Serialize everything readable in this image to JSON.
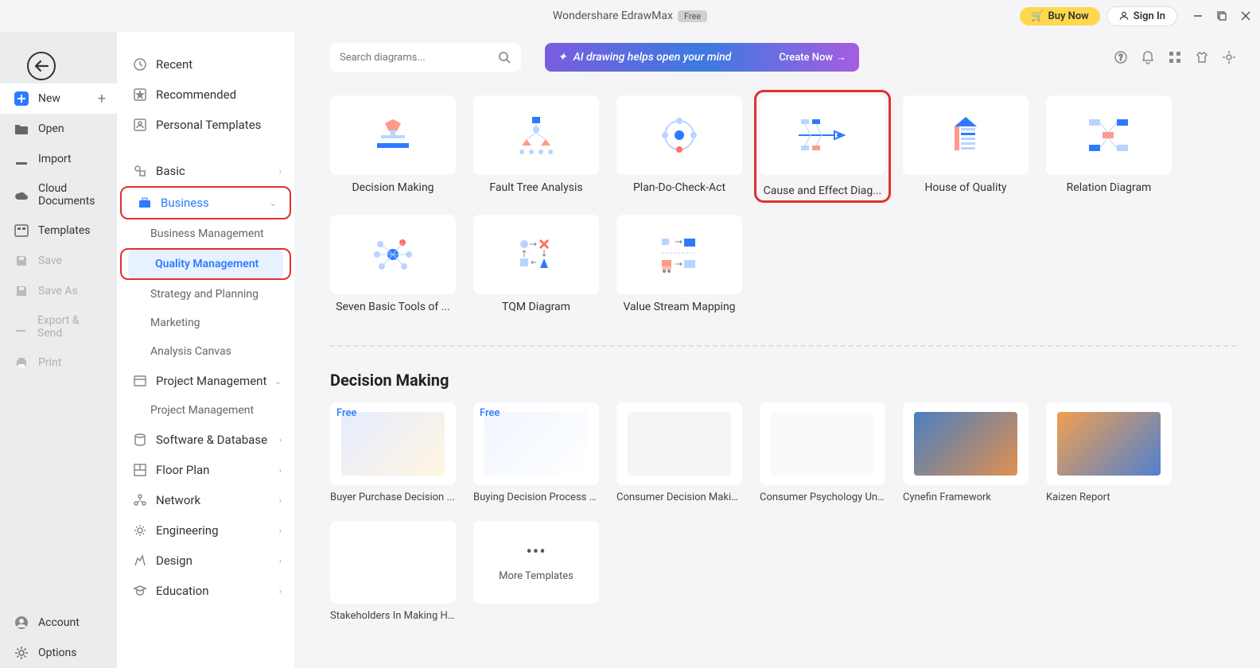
{
  "titlebar": {
    "app_name": "Wondershare EdrawMax",
    "badge": "Free",
    "buy_now": "Buy Now",
    "sign_in": "Sign In"
  },
  "leftbar": {
    "new": "New",
    "open": "Open",
    "import": "Import",
    "cloud_documents": "Cloud Documents",
    "templates": "Templates",
    "save": "Save",
    "save_as": "Save As",
    "export_send": "Export & Send",
    "print": "Print",
    "account": "Account",
    "options": "Options"
  },
  "categories": {
    "recent": "Recent",
    "recommended": "Recommended",
    "personal_templates": "Personal Templates",
    "basic": "Basic",
    "business": "Business",
    "business_subs": {
      "business_management": "Business Management",
      "quality_management": "Quality Management",
      "strategy_planning": "Strategy and Planning",
      "marketing": "Marketing",
      "analysis_canvas": "Analysis Canvas"
    },
    "project_management": "Project Management",
    "project_management_sub": "Project Management",
    "software_database": "Software & Database",
    "floor_plan": "Floor Plan",
    "network": "Network",
    "engineering": "Engineering",
    "design": "Design",
    "education": "Education"
  },
  "search": {
    "placeholder": "Search diagrams..."
  },
  "ai_banner": {
    "text": "AI drawing helps open your mind",
    "cta": "Create Now"
  },
  "cards": [
    "Decision Making",
    "Fault Tree Analysis",
    "Plan-Do-Check-Act",
    "Cause and Effect Diag...",
    "House of Quality",
    "Relation Diagram",
    "Seven Basic Tools of ...",
    "TQM Diagram",
    "Value Stream Mapping"
  ],
  "section_title": "Decision Making",
  "templates": [
    {
      "label": "Buyer Purchase Decision ...",
      "free": true
    },
    {
      "label": "Buying Decision Process O...",
      "free": true
    },
    {
      "label": "Consumer Decision Makin...",
      "free": false
    },
    {
      "label": "Consumer Psychology Un...",
      "free": false
    },
    {
      "label": "Cynefin Framework",
      "free": false
    },
    {
      "label": "Kaizen Report",
      "free": false
    },
    {
      "label": "Stakeholders In Making He...",
      "free": false
    }
  ],
  "more_templates": "More Templates",
  "free_tag": "Free"
}
